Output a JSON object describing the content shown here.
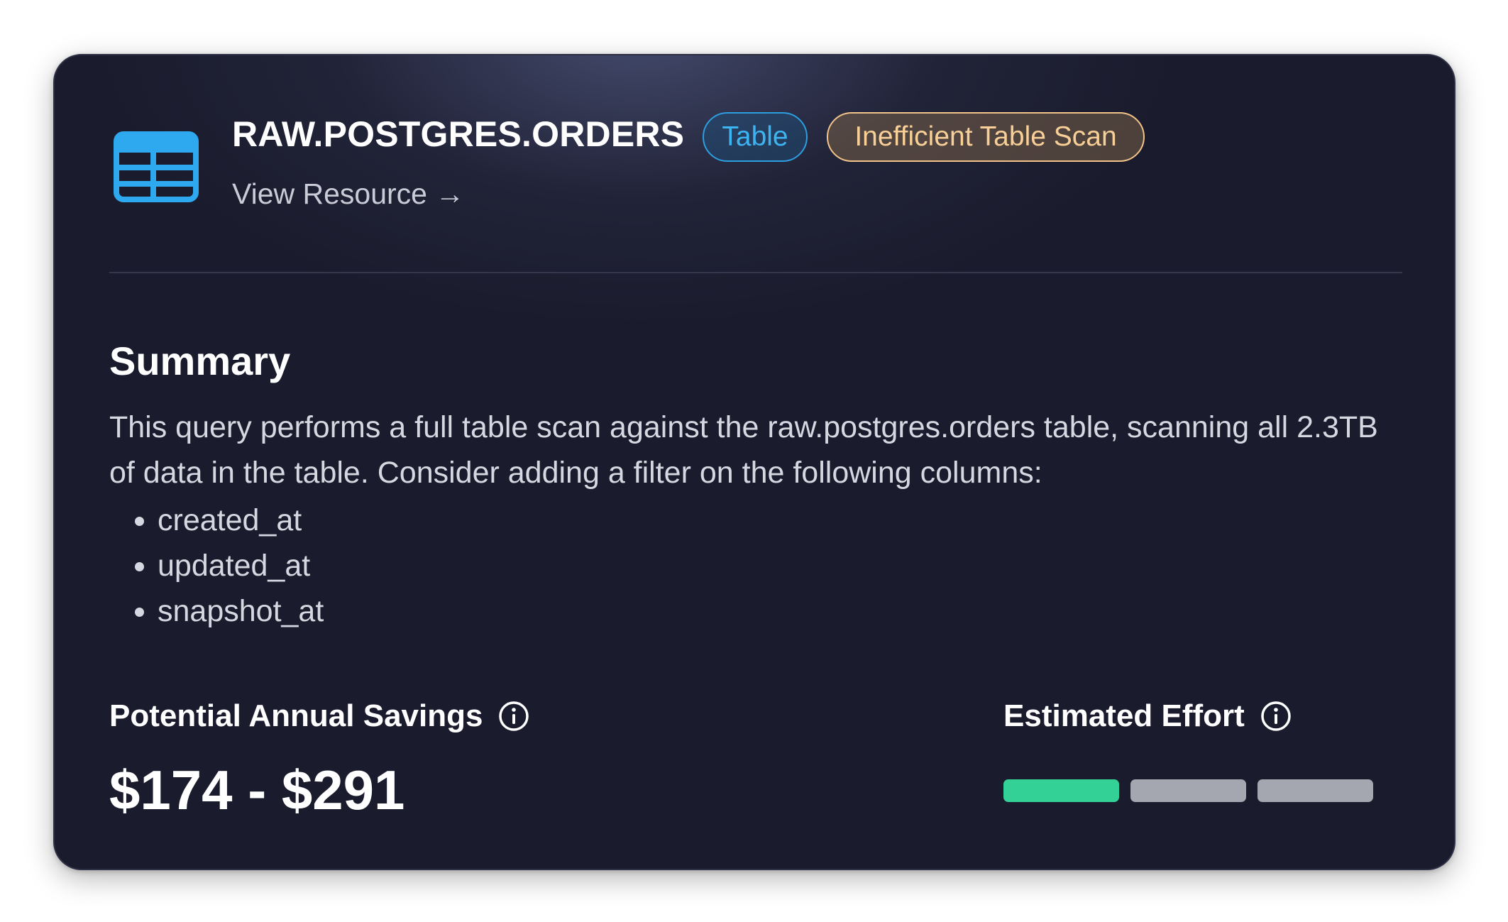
{
  "resource": {
    "name": "RAW.POSTGRES.ORDERS",
    "type_badge": "Table",
    "issue_badge": "Inefficient Table Scan",
    "view_link": "View Resource →",
    "icon": "table-icon"
  },
  "summary": {
    "heading": "Summary",
    "text": "This query performs a full table scan against the raw.postgres.orders table, scanning all 2.3TB of data in the table. Consider adding a filter on the following columns:",
    "columns": [
      "created_at",
      "updated_at",
      "snapshot_at"
    ]
  },
  "savings": {
    "label": "Potential Annual Savings",
    "value": "$174 - $291",
    "icon": "info-icon"
  },
  "effort": {
    "label": "Estimated Effort",
    "icon": "info-icon",
    "level": 1,
    "max_level": 3
  },
  "colors": {
    "card_background": "#1a1b2c",
    "type_badge": "#3db4f2",
    "issue_badge": "#f7cf97",
    "effort_active": "#34d196",
    "effort_inactive": "#a5a7b0"
  }
}
